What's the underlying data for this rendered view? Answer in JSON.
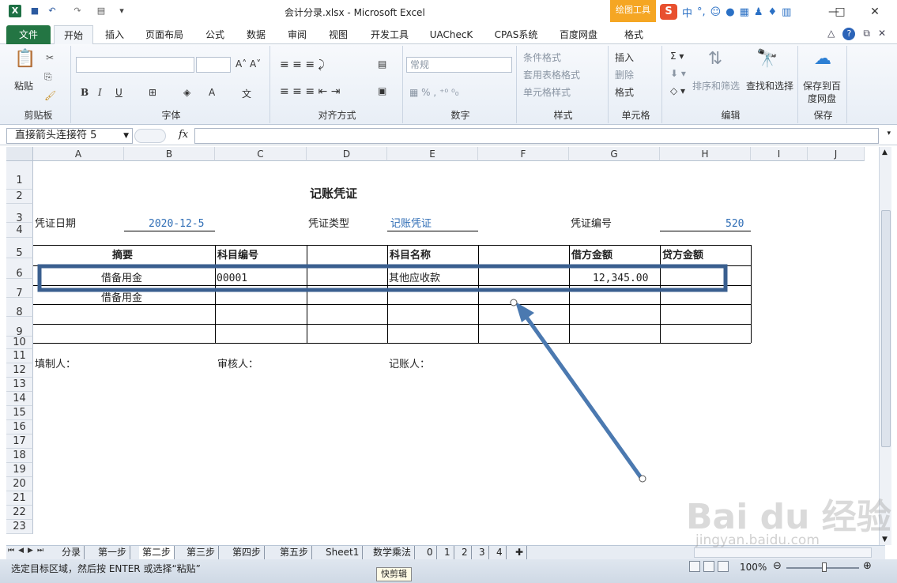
{
  "window": {
    "title": "会计分录.xlsx - Microsoft Excel",
    "contextual_tab": "绘图工具",
    "ime_label": "中",
    "app_icon": "X"
  },
  "ribbon_tabs": [
    "文件",
    "开始",
    "插入",
    "页面布局",
    "公式",
    "数据",
    "审阅",
    "视图",
    "开发工具",
    "UAChecK",
    "CPAS系统",
    "百度网盘",
    "格式"
  ],
  "active_tab": "开始",
  "ribbon": {
    "clipboard": {
      "label": "剪贴板",
      "paste": "粘贴"
    },
    "font": {
      "label": "字体"
    },
    "alignment": {
      "label": "对齐方式"
    },
    "number": {
      "label": "数字",
      "format_value": "常规"
    },
    "styles": {
      "label": "样式",
      "conditional": "条件格式",
      "table": "套用表格格式",
      "cell": "单元格样式"
    },
    "cells": {
      "label": "单元格",
      "insert": "插入",
      "delete": "删除",
      "format": "格式"
    },
    "editing": {
      "label": "编辑",
      "sort": "排序和筛选",
      "find": "查找和选择"
    },
    "save": {
      "label": "保存",
      "button_line1": "保存到百",
      "button_line2": "度网盘"
    }
  },
  "formula_bar": {
    "name_box": "直接箭头连接符 5",
    "fx": "fx",
    "value": ""
  },
  "columns": [
    "A",
    "B",
    "C",
    "D",
    "E",
    "F",
    "G",
    "H",
    "I",
    "J"
  ],
  "rows": [
    "1",
    "2",
    "3",
    "4",
    "5",
    "6",
    "7",
    "8",
    "9",
    "10",
    "11",
    "12",
    "13",
    "14",
    "15",
    "16",
    "17",
    "18",
    "19",
    "20",
    "21",
    "22",
    "23"
  ],
  "sheet": {
    "title": "记账凭证",
    "date_label": "凭证日期",
    "date_value": "2020-12-5",
    "type_label": "凭证类型",
    "type_value": "记账凭证",
    "number_label": "凭证编号",
    "number_value": "520",
    "headers": {
      "summary": "摘要",
      "account_code": "科目编号",
      "account_name": "科目名称",
      "debit": "借方金额",
      "credit": "贷方金额"
    },
    "row6": {
      "summary": "借备用金",
      "account_code": "00001",
      "account_name": "其他应收款",
      "debit": "12,345.00"
    },
    "row7": {
      "summary": "借备用金"
    },
    "preparer_label": "填制人：",
    "reviewer_label": "审核人：",
    "bookkeeper_label": "记账人："
  },
  "sheet_tabs": [
    "分录",
    "第一步",
    "第二步",
    "第三步",
    "第四步",
    "第五步",
    "Sheet1",
    "数学乘法",
    "0",
    "1",
    "2",
    "3",
    "4"
  ],
  "active_sheet": "第二步",
  "status": {
    "message": "选定目标区域，然后按 ENTER 或选择“粘贴”",
    "tooltip": "快剪辑",
    "zoom": "100%"
  },
  "watermark": {
    "text": "Bai du 经验",
    "url": "jingyan.baidu.com"
  },
  "colors": {
    "excel_green": "#237543",
    "annotation_blue": "#3a5f8f",
    "link_blue": "#2f6db5",
    "drawing_tab": "#f5a623"
  }
}
